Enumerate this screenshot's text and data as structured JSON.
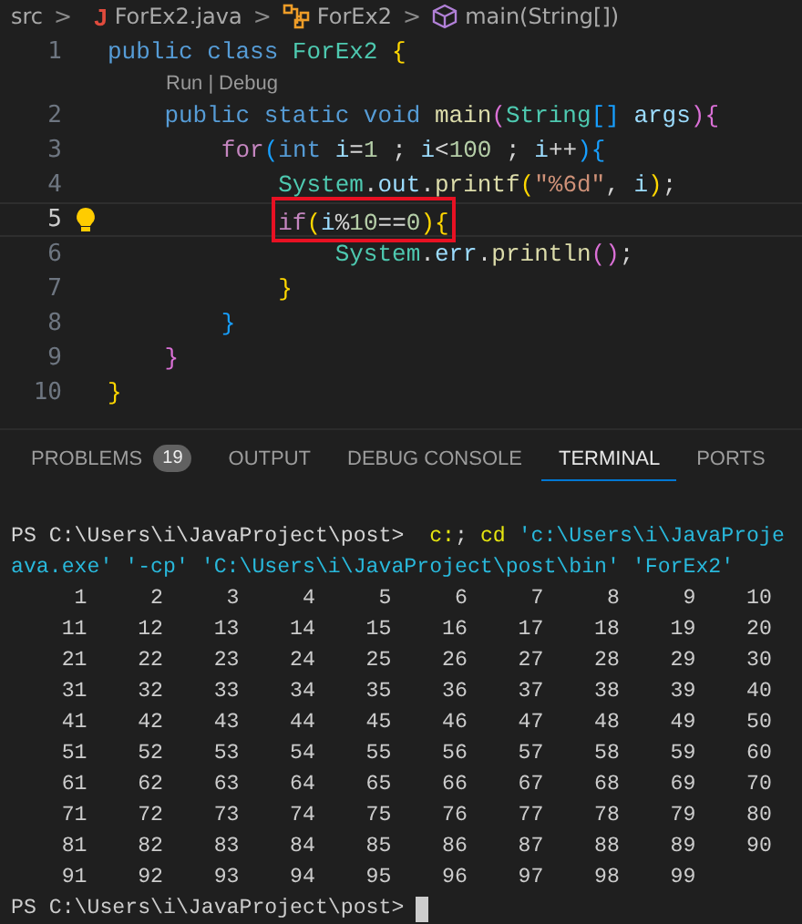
{
  "breadcrumb": [
    {
      "kind": "folder",
      "label": "src"
    },
    {
      "kind": "file",
      "glyph": "J",
      "label": "ForEx2.java"
    },
    {
      "kind": "class",
      "label": "ForEx2"
    },
    {
      "kind": "method",
      "label": "main(String[])"
    }
  ],
  "separator": ">",
  "editor": {
    "lines": [
      {
        "number": "1",
        "current": false,
        "lightbulb": false,
        "boxed": false,
        "tokens": [
          {
            "text": "public class ",
            "kind": "keyword"
          },
          {
            "text": "ForEx2 ",
            "kind": "type"
          },
          {
            "text": "{",
            "kind": "bracket1"
          }
        ]
      },
      {
        "number": "2",
        "current": false,
        "lightbulb": false,
        "boxed": false,
        "codelens": {
          "actions": [
            "Run",
            "Debug"
          ],
          "separator": "|"
        },
        "tokens": [
          {
            "text": "    public static void ",
            "kind": "keyword"
          },
          {
            "text": "main",
            "kind": "function"
          },
          {
            "text": "(",
            "kind": "bracket2"
          },
          {
            "text": "String",
            "kind": "type"
          },
          {
            "text": "[] ",
            "kind": "bracket3"
          },
          {
            "text": "args",
            "kind": "variable"
          },
          {
            "text": "){",
            "kind": "bracket2"
          }
        ]
      },
      {
        "number": "3",
        "current": false,
        "lightbulb": false,
        "boxed": false,
        "tokens": [
          {
            "text": "        for",
            "kind": "control"
          },
          {
            "text": "(",
            "kind": "bracket3"
          },
          {
            "text": "int ",
            "kind": "keyword"
          },
          {
            "text": "i",
            "kind": "variable"
          },
          {
            "text": "=",
            "kind": "plain"
          },
          {
            "text": "1",
            "kind": "number"
          },
          {
            "text": " ; ",
            "kind": "plain"
          },
          {
            "text": "i",
            "kind": "variable"
          },
          {
            "text": "<",
            "kind": "plain"
          },
          {
            "text": "100",
            "kind": "number"
          },
          {
            "text": " ; ",
            "kind": "plain"
          },
          {
            "text": "i",
            "kind": "variable"
          },
          {
            "text": "++",
            "kind": "plain"
          },
          {
            "text": "){",
            "kind": "bracket3"
          }
        ]
      },
      {
        "number": "4",
        "current": false,
        "lightbulb": false,
        "boxed": false,
        "tokens": [
          {
            "text": "            System",
            "kind": "type"
          },
          {
            "text": ".",
            "kind": "plain"
          },
          {
            "text": "out",
            "kind": "variable"
          },
          {
            "text": ".",
            "kind": "plain"
          },
          {
            "text": "printf",
            "kind": "function"
          },
          {
            "text": "(",
            "kind": "bracket1"
          },
          {
            "text": "\"%6d\"",
            "kind": "string"
          },
          {
            "text": ", ",
            "kind": "plain"
          },
          {
            "text": "i",
            "kind": "variable"
          },
          {
            "text": ")",
            "kind": "bracket1"
          },
          {
            "text": ";",
            "kind": "plain"
          }
        ]
      },
      {
        "number": "5",
        "current": true,
        "lightbulb": true,
        "boxed": true,
        "tokens": [
          {
            "text": "            if",
            "kind": "control"
          },
          {
            "text": "(",
            "kind": "bracket1"
          },
          {
            "text": "i",
            "kind": "variable"
          },
          {
            "text": "%",
            "kind": "plain"
          },
          {
            "text": "10",
            "kind": "number"
          },
          {
            "text": "==",
            "kind": "plain"
          },
          {
            "text": "0",
            "kind": "number"
          },
          {
            "text": "){",
            "kind": "bracket1"
          }
        ]
      },
      {
        "number": "6",
        "current": false,
        "lightbulb": false,
        "boxed": false,
        "tokens": [
          {
            "text": "                System",
            "kind": "type"
          },
          {
            "text": ".",
            "kind": "plain"
          },
          {
            "text": "err",
            "kind": "variable"
          },
          {
            "text": ".",
            "kind": "plain"
          },
          {
            "text": "println",
            "kind": "function"
          },
          {
            "text": "()",
            "kind": "bracket2"
          },
          {
            "text": ";",
            "kind": "plain"
          }
        ]
      },
      {
        "number": "7",
        "current": false,
        "lightbulb": false,
        "boxed": false,
        "tokens": [
          {
            "text": "            }",
            "kind": "bracket1"
          }
        ]
      },
      {
        "number": "8",
        "current": false,
        "lightbulb": false,
        "boxed": false,
        "tokens": [
          {
            "text": "        }",
            "kind": "bracket3"
          }
        ]
      },
      {
        "number": "9",
        "current": false,
        "lightbulb": false,
        "boxed": false,
        "tokens": [
          {
            "text": "    }",
            "kind": "bracket2"
          }
        ]
      },
      {
        "number": "10",
        "current": false,
        "lightbulb": false,
        "boxed": false,
        "tokens": [
          {
            "text": "}",
            "kind": "bracket1"
          }
        ]
      }
    ]
  },
  "panel": {
    "tabs": [
      {
        "label": "PROBLEMS",
        "badge": "19",
        "selected": false
      },
      {
        "label": "OUTPUT",
        "selected": false
      },
      {
        "label": "DEBUG CONSOLE",
        "selected": false
      },
      {
        "label": "TERMINAL",
        "selected": true
      },
      {
        "label": "PORTS",
        "selected": false
      }
    ],
    "terminal": {
      "lines": [
        [
          {
            "text": "PS C:\\Users\\i\\JavaProject\\post>  ",
            "kind": "plain"
          },
          {
            "text": "c:",
            "kind": "command"
          },
          {
            "text": "; ",
            "kind": "plain"
          },
          {
            "text": "cd ",
            "kind": "command"
          },
          {
            "text": "'c:\\Users\\i\\JavaProje",
            "kind": "argument"
          }
        ],
        [
          {
            "text": "ava.exe' '-cp' 'C:\\Users\\i\\JavaProject\\post\\bin' 'ForEx2'",
            "kind": "argument"
          }
        ]
      ],
      "output_rows": [
        "     1     2     3     4     5     6     7     8     9    10",
        "    11    12    13    14    15    16    17    18    19    20",
        "    21    22    23    24    25    26    27    28    29    30",
        "    31    32    33    34    35    36    37    38    39    40",
        "    41    42    43    44    45    46    47    48    49    50",
        "    51    52    53    54    55    56    57    58    59    60",
        "    61    62    63    64    65    66    67    68    69    70",
        "    71    72    73    74    75    76    77    78    79    80",
        "    81    82    83    84    85    86    87    88    89    90",
        "    91    92    93    94    95    96    97    98    99"
      ],
      "prompt": "PS C:\\Users\\i\\JavaProject\\post>",
      "cursor": true
    }
  }
}
